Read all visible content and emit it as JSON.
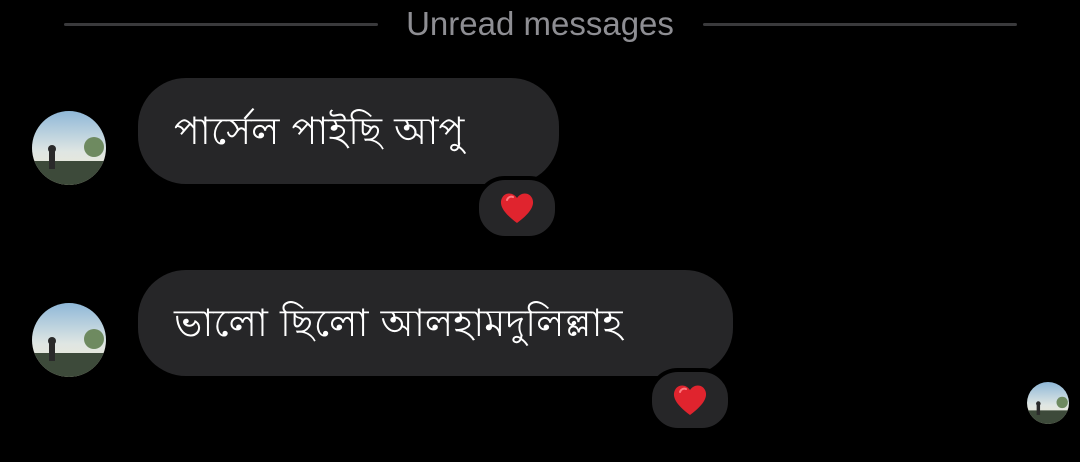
{
  "divider": {
    "label": "Unread messages"
  },
  "messages": [
    {
      "text": "পার্সেল পাইছি আপু",
      "reaction_icon": "red-heart-icon"
    },
    {
      "text": "ভালো ছিলো আলহামদুলিল্লাহ",
      "reaction_icon": "red-heart-icon"
    }
  ],
  "colors": {
    "background": "#000000",
    "bubble": "#262628",
    "divider_text": "#8e8e93",
    "divider_line": "#3a3a3c",
    "heart": "#e0242e"
  },
  "icons": {
    "avatar": "contact-avatar",
    "seen_avatar": "seen-receipt-avatar"
  }
}
